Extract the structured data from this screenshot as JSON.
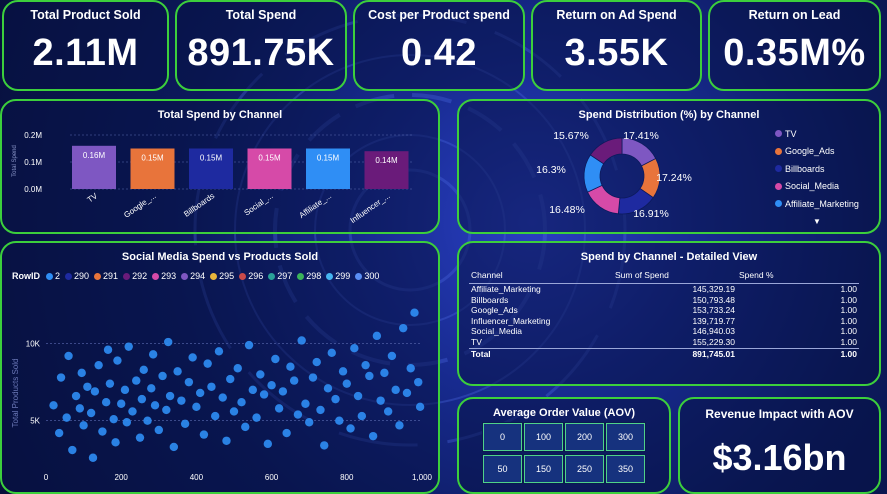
{
  "kpis": [
    {
      "title": "Total Product Sold",
      "value": "2.11M"
    },
    {
      "title": "Total Spend",
      "value": "891.75K"
    },
    {
      "title": "Cost per Product spend",
      "value": "0.42"
    },
    {
      "title": "Return on Ad Spend",
      "value": "3.55K"
    },
    {
      "title": "Return on Lead",
      "value": "0.35M%"
    }
  ],
  "spend_by_channel": {
    "title": "Total Spend by Channel",
    "ylabel": "Total Spend",
    "y_ticks": [
      "0.0M",
      "0.1M",
      "0.2M"
    ],
    "bars": [
      {
        "label": "TV",
        "value_label": "0.16M",
        "color": "#7e57c2"
      },
      {
        "label": "Google_...",
        "value_label": "0.15M",
        "color": "#e8743b"
      },
      {
        "label": "Billboards",
        "value_label": "0.15M",
        "color": "#1e2aa0"
      },
      {
        "label": "Social_...",
        "value_label": "0.15M",
        "color": "#d64aa8"
      },
      {
        "label": "Affiliate_...",
        "value_label": "0.15M",
        "color": "#2f8ef5"
      },
      {
        "label": "Influencer_...",
        "value_label": "0.14M",
        "color": "#6a1b7a"
      }
    ]
  },
  "spend_distribution": {
    "title": "Spend Distribution (%) by Channel",
    "slice_labels": [
      "17.41%",
      "17.24%",
      "16.91%",
      "16.48%",
      "16.3%",
      "15.67%"
    ],
    "legend": [
      {
        "label": "TV",
        "color": "#7e57c2"
      },
      {
        "label": "Google_Ads",
        "color": "#e8743b"
      },
      {
        "label": "Billboards",
        "color": "#1e2aa0"
      },
      {
        "label": "Social_Media",
        "color": "#d64aa8"
      },
      {
        "label": "Affiliate_Marketing",
        "color": "#2f8ef5"
      }
    ],
    "more_icon": "triangle-down-icon"
  },
  "scatter": {
    "title": "Social Media Spend vs Products Sold",
    "legend_title": "RowID",
    "legend_items": [
      {
        "label": "2",
        "color": "#2f8ef5"
      },
      {
        "label": "290",
        "color": "#1e2aa0"
      },
      {
        "label": "291",
        "color": "#e8743b"
      },
      {
        "label": "292",
        "color": "#6a1b7a"
      },
      {
        "label": "293",
        "color": "#d64aa8"
      },
      {
        "label": "294",
        "color": "#7e57c2"
      },
      {
        "label": "295",
        "color": "#e8b53b"
      },
      {
        "label": "296",
        "color": "#c94a4a"
      },
      {
        "label": "297",
        "color": "#2aa198"
      },
      {
        "label": "298",
        "color": "#3bb35a"
      },
      {
        "label": "299",
        "color": "#46b4f0"
      },
      {
        "label": "300",
        "color": "#5a8ef5"
      }
    ],
    "ylabel": "Total Products Sold",
    "y_ticks": [
      "5K",
      "10K"
    ],
    "x_ticks": [
      "0",
      "200",
      "400",
      "600",
      "800",
      "1,000"
    ]
  },
  "detail": {
    "title": "Spend by Channel - Detailed View",
    "columns": [
      "Channel",
      "Sum of Spend",
      "Spend %"
    ],
    "rows": [
      [
        "Affiliate_Marketing",
        "145,329.19",
        "1.00"
      ],
      [
        "Billboards",
        "150,793.48",
        "1.00"
      ],
      [
        "Google_Ads",
        "153,733.24",
        "1.00"
      ],
      [
        "Influencer_Marketing",
        "139,719.77",
        "1.00"
      ],
      [
        "Social_Media",
        "146,940.03",
        "1.00"
      ],
      [
        "TV",
        "155,229.30",
        "1.00"
      ]
    ],
    "total": [
      "Total",
      "891,745.01",
      "1.00"
    ]
  },
  "aov": {
    "title": "Average Order Value (AOV)",
    "buttons": [
      "0",
      "100",
      "200",
      "300",
      "50",
      "150",
      "250",
      "350"
    ]
  },
  "revenue": {
    "title": "Revenue Impact with AOV",
    "value": "$3.16bn"
  },
  "chart_data": [
    {
      "type": "bar",
      "title": "Total Spend by Channel",
      "ylabel": "Total Spend",
      "categories": [
        "TV",
        "Google_...",
        "Billboards",
        "Social_...",
        "Affiliate_...",
        "Influencer_..."
      ],
      "values": [
        0.16,
        0.15,
        0.15,
        0.15,
        0.15,
        0.14
      ],
      "unit": "M",
      "ylim": [
        0,
        0.2
      ]
    },
    {
      "type": "pie",
      "title": "Spend Distribution (%) by Channel",
      "categories": [
        "TV",
        "Google_Ads",
        "Billboards",
        "Social_Media",
        "Affiliate_Marketing",
        "Influencer_Marketing"
      ],
      "values": [
        17.41,
        17.24,
        16.91,
        16.48,
        16.3,
        15.67
      ],
      "colors": [
        "#7e57c2",
        "#e8743b",
        "#1e2aa0",
        "#d64aa8",
        "#2f8ef5",
        "#6a1b7a"
      ]
    },
    {
      "type": "scatter",
      "title": "Social Media Spend vs Products Sold",
      "xlim": [
        0,
        1000
      ],
      "ylim": [
        2000,
        12500
      ],
      "color": "#2f8ef5",
      "points": [
        [
          20,
          6000
        ],
        [
          35,
          4200
        ],
        [
          40,
          7800
        ],
        [
          55,
          5200
        ],
        [
          60,
          9200
        ],
        [
          70,
          3100
        ],
        [
          80,
          6600
        ],
        [
          90,
          5800
        ],
        [
          95,
          8100
        ],
        [
          100,
          4700
        ],
        [
          110,
          7200
        ],
        [
          120,
          5500
        ],
        [
          125,
          2600
        ],
        [
          130,
          6900
        ],
        [
          140,
          8600
        ],
        [
          150,
          4300
        ],
        [
          160,
          6200
        ],
        [
          165,
          9600
        ],
        [
          170,
          7400
        ],
        [
          180,
          5100
        ],
        [
          185,
          3600
        ],
        [
          190,
          8900
        ],
        [
          200,
          6100
        ],
        [
          210,
          7000
        ],
        [
          215,
          4900
        ],
        [
          220,
          9800
        ],
        [
          230,
          5600
        ],
        [
          240,
          7600
        ],
        [
          250,
          3900
        ],
        [
          255,
          6400
        ],
        [
          260,
          8300
        ],
        [
          270,
          5000
        ],
        [
          280,
          7100
        ],
        [
          285,
          9300
        ],
        [
          290,
          6000
        ],
        [
          300,
          4400
        ],
        [
          310,
          7900
        ],
        [
          320,
          5700
        ],
        [
          325,
          10100
        ],
        [
          330,
          6600
        ],
        [
          340,
          3300
        ],
        [
          350,
          8200
        ],
        [
          360,
          6300
        ],
        [
          370,
          4800
        ],
        [
          380,
          7500
        ],
        [
          390,
          9100
        ],
        [
          400,
          5900
        ],
        [
          410,
          6800
        ],
        [
          420,
          4100
        ],
        [
          430,
          8700
        ],
        [
          440,
          7200
        ],
        [
          450,
          5300
        ],
        [
          460,
          9500
        ],
        [
          470,
          6500
        ],
        [
          480,
          3700
        ],
        [
          490,
          7700
        ],
        [
          500,
          5600
        ],
        [
          510,
          8400
        ],
        [
          520,
          6200
        ],
        [
          530,
          4600
        ],
        [
          540,
          9900
        ],
        [
          550,
          7000
        ],
        [
          560,
          5200
        ],
        [
          570,
          8000
        ],
        [
          580,
          6700
        ],
        [
          590,
          3500
        ],
        [
          600,
          7300
        ],
        [
          610,
          9000
        ],
        [
          620,
          5800
        ],
        [
          630,
          6900
        ],
        [
          640,
          4200
        ],
        [
          650,
          8500
        ],
        [
          660,
          7600
        ],
        [
          670,
          5400
        ],
        [
          680,
          10200
        ],
        [
          690,
          6100
        ],
        [
          700,
          4900
        ],
        [
          710,
          7800
        ],
        [
          720,
          8800
        ],
        [
          730,
          5700
        ],
        [
          740,
          3400
        ],
        [
          750,
          7100
        ],
        [
          760,
          9400
        ],
        [
          770,
          6400
        ],
        [
          780,
          5000
        ],
        [
          790,
          8200
        ],
        [
          800,
          7400
        ],
        [
          810,
          4500
        ],
        [
          820,
          9700
        ],
        [
          830,
          6600
        ],
        [
          840,
          5300
        ],
        [
          850,
          8600
        ],
        [
          860,
          7900
        ],
        [
          870,
          4000
        ],
        [
          880,
          10500
        ],
        [
          890,
          6300
        ],
        [
          900,
          8100
        ],
        [
          910,
          5600
        ],
        [
          920,
          9200
        ],
        [
          930,
          7000
        ],
        [
          940,
          4700
        ],
        [
          950,
          11000
        ],
        [
          960,
          6800
        ],
        [
          970,
          8400
        ],
        [
          980,
          12000
        ],
        [
          990,
          7500
        ],
        [
          995,
          5900
        ]
      ]
    }
  ]
}
